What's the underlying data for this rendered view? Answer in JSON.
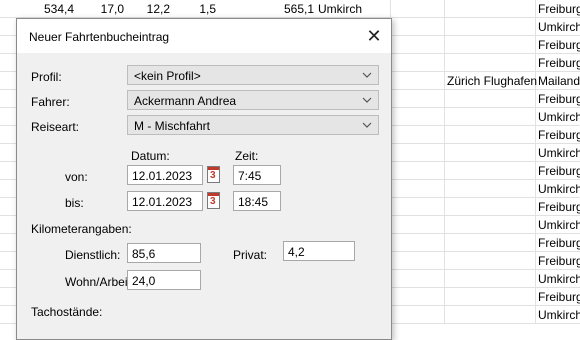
{
  "sheet": {
    "top_row": {
      "c1": "534,4",
      "c2": "17,0",
      "c3": "12,2",
      "c4": "1,5",
      "c5": "565,1",
      "c6": "Umkirch",
      "c7": "Freiburg"
    },
    "right_col": [
      "Freiburg",
      "Umkirch",
      "Freiburg",
      "Freiburg",
      "Mailand",
      "Freiburg",
      "Umkirch",
      "Freiburg",
      "Umkirch",
      "Freiburg",
      "Umkirch",
      "Freiburg",
      "Umkirch",
      "Freiburg",
      "Freiburg",
      "Umkirch",
      "Freiburg",
      "Umkirch"
    ],
    "middle_note": "Zürich Flughafen"
  },
  "dialog": {
    "title": "Neuer Fahrtenbucheintrag",
    "profil_label": "Profil:",
    "profil_value": "<kein Profil>",
    "fahrer_label": "Fahrer:",
    "fahrer_value": "Ackermann Andrea",
    "reiseart_label": "Reiseart:",
    "reiseart_value": "M - Mischfahrt",
    "datum_header": "Datum:",
    "zeit_header": "Zeit:",
    "von_label": "von:",
    "von_datum": "12.01.2023",
    "von_zeit": "7:45",
    "bis_label": "bis:",
    "bis_datum": "12.01.2023",
    "bis_zeit": "18:45",
    "km_section": "Kilometerangaben:",
    "dienstlich_label": "Dienstlich:",
    "dienstlich_value": "85,6",
    "privat_label": "Privat:",
    "privat_value": "4,2",
    "wohnarbeit_label": "Wohn/Arbeit:",
    "wohnarbeit_value": "24,0",
    "tacho_section": "Tachostände:",
    "calendar_number": "3"
  }
}
